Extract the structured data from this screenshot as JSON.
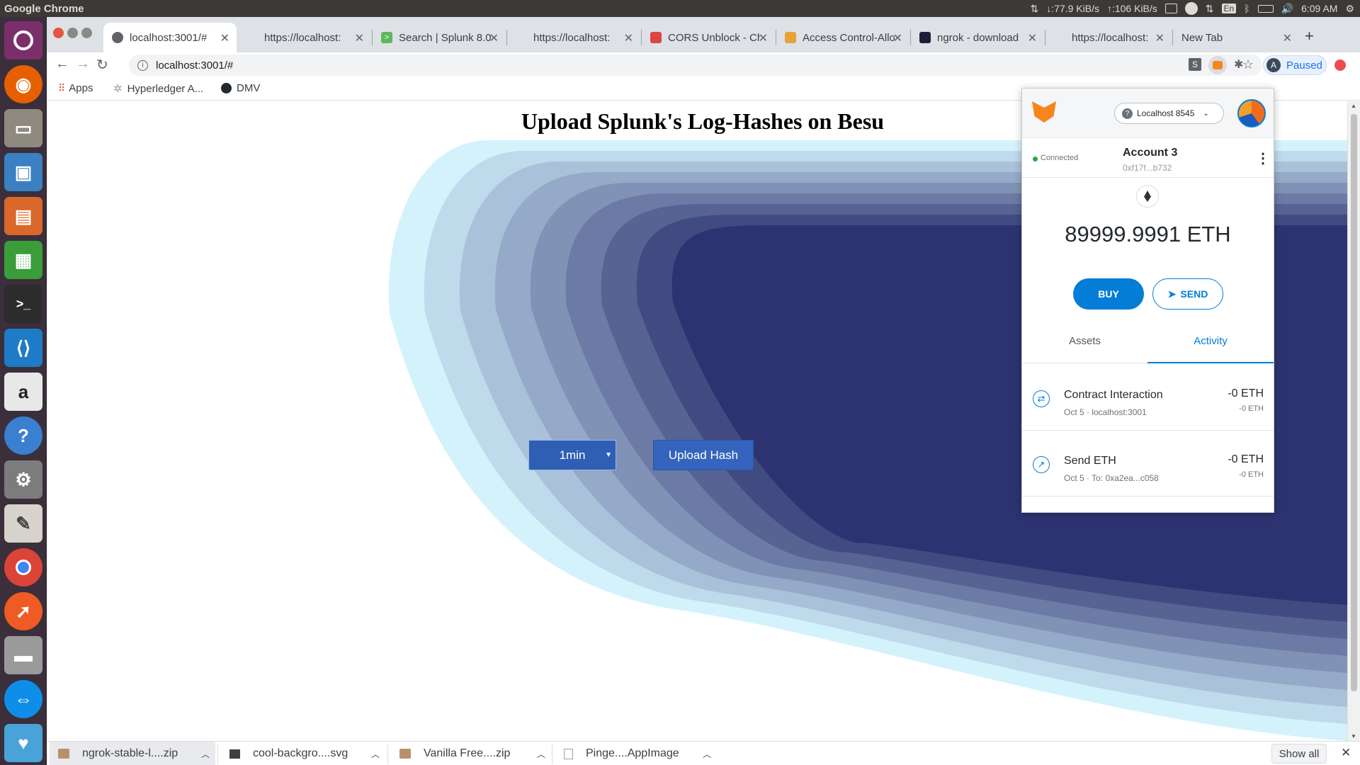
{
  "system": {
    "app_name": "Google Chrome",
    "net_down": "↓:77.9 KiB/s",
    "net_up": "↑:106 KiB/s",
    "kbd": "En",
    "clock": "6:09 AM"
  },
  "launcher": {
    "icons": [
      "ubuntu-dash-icon",
      "firefox-icon",
      "files-icon",
      "image-viewer-icon",
      "impress-icon",
      "calc-icon",
      "terminal-icon",
      "vscode-icon",
      "amazon-icon",
      "help-icon",
      "system-settings-icon",
      "text-editor-icon",
      "chrome-icon",
      "postman-icon",
      "disks-icon",
      "teamviewer-icon",
      "vpn-icon"
    ]
  },
  "tabs": [
    {
      "title": "localhost:3001/#",
      "active": true
    },
    {
      "title": "https://localhost:"
    },
    {
      "title": "Search | Splunk 8.0"
    },
    {
      "title": "https://localhost:"
    },
    {
      "title": "CORS Unblock - Chr"
    },
    {
      "title": "Access Control-Allo"
    },
    {
      "title": "ngrok - download"
    },
    {
      "title": "https://localhost:"
    },
    {
      "title": "New Tab"
    }
  ],
  "new_tab_symbol": "+",
  "address": {
    "url": "localhost:3001/#",
    "profile_letter": "A",
    "profile_status": "Paused"
  },
  "bookmarks": {
    "apps": "Apps",
    "items": [
      "Hyperledger A...",
      "DMV"
    ]
  },
  "page": {
    "heading": "Upload Splunk's Log-Hashes on Besu",
    "interval_selected": "1min",
    "upload_button": "Upload Hash"
  },
  "metamask": {
    "network": "Localhost 8545",
    "status": "Connected",
    "account_name": "Account 3",
    "account_address": "0xf17f...b732",
    "balance": "89999.9991 ETH",
    "buy": "BUY",
    "send": "SEND",
    "tab_assets": "Assets",
    "tab_activity": "Activity",
    "activity": [
      {
        "title": "Contract Interaction",
        "subtitle": "Oct 5 · localhost:3001",
        "amount": "-0 ETH",
        "amount_sub": "-0 ETH"
      },
      {
        "title": "Send ETH",
        "subtitle": "Oct 5 · To: 0xa2ea...c058",
        "amount": "-0 ETH",
        "amount_sub": "-0 ETH"
      }
    ]
  },
  "downloads": {
    "items": [
      "ngrok-stable-l....zip",
      "cool-backgro....svg",
      "Vanilla Free....zip",
      "Pinge....AppImage"
    ],
    "show_all": "Show all"
  },
  "colors": {
    "accent": "#037dd6",
    "button_blue": "#2e5fb5",
    "wave_dark": "#2c3370",
    "wave_light": "#d4f2fc"
  }
}
